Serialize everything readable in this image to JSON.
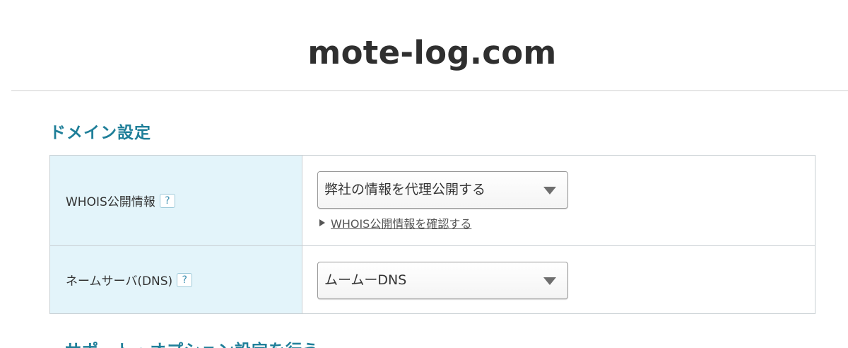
{
  "header": {
    "domain_name": "mote-log.com"
  },
  "section": {
    "title": "ドメイン設定"
  },
  "settings": {
    "whois": {
      "label": "WHOIS公開情報",
      "help": "?",
      "selected": "弊社の情報を代理公開する",
      "link": "WHOIS公開情報を確認する"
    },
    "nameserver": {
      "label": "ネームサーバ(DNS)",
      "help": "?",
      "selected": "ムームーDNS"
    }
  },
  "next_section": {
    "title_partial": "サポート・オプション設定を行う"
  },
  "colors": {
    "accent": "#1f7f99",
    "label_bg": "#e3f4fa",
    "border": "#c8cfd3"
  }
}
